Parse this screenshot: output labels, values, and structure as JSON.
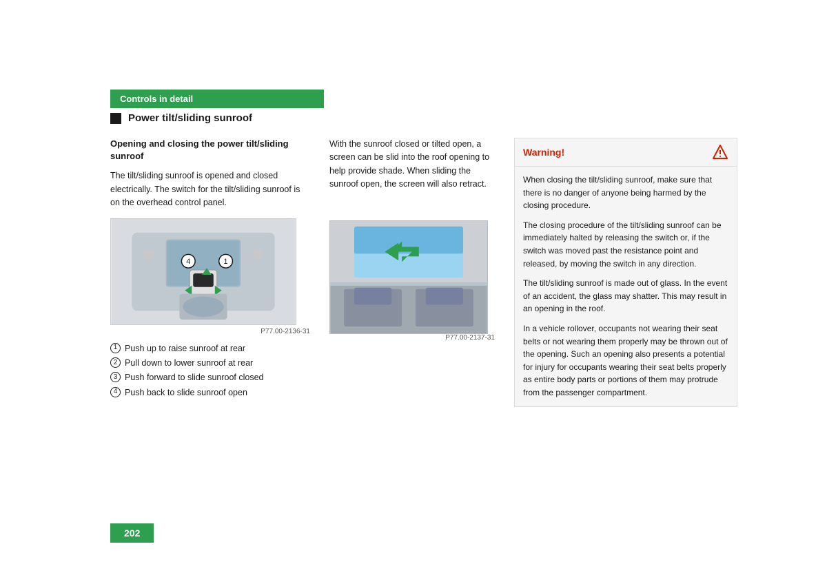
{
  "header": {
    "banner_label": "Controls in detail",
    "section_title": "Power tilt/sliding sunroof",
    "banner_color": "#2e9e4f"
  },
  "left_column": {
    "subsection_title": "Opening and closing the power tilt/sliding sunroof",
    "body_text": "The tilt/sliding sunroof is opened and closed electrically. The switch for the tilt/sliding sunroof is on the overhead control panel.",
    "diagram_caption": "P77.00-2136-31",
    "list_items": [
      {
        "number": "1",
        "text": "Push up to raise sunroof at rear"
      },
      {
        "number": "2",
        "text": "Pull down to lower sunroof at rear"
      },
      {
        "number": "3",
        "text": "Push forward to slide sunroof closed"
      },
      {
        "number": "4",
        "text": "Push back to slide sunroof open"
      }
    ]
  },
  "middle_column": {
    "body_text": "With the sunroof closed or tilted open, a screen can be slid into the roof opening to help provide shade. When sliding the sunroof open, the screen will also retract.",
    "photo_caption": "P77.00-2137-31"
  },
  "right_column": {
    "warning_title": "Warning!",
    "warning_paragraphs": [
      "When closing the tilt/sliding sunroof, make sure that there is no danger of anyone being harmed by the closing procedure.",
      "The closing procedure of the tilt/sliding sunroof can be immediately halted by releasing the switch or, if the switch was moved past the resistance point and released, by moving the switch in any direction.",
      "The tilt/sliding sunroof is made out of glass. In the event of an accident, the glass may shatter. This may result in an opening in the roof.",
      "In a vehicle rollover, occupants not wearing their seat belts or not wearing them properly may be thrown out of the opening. Such an opening also presents a potential for injury for occupants wearing their seat belts properly as entire body parts or portions of them may protrude from the passenger compartment."
    ]
  },
  "page_number": "202"
}
